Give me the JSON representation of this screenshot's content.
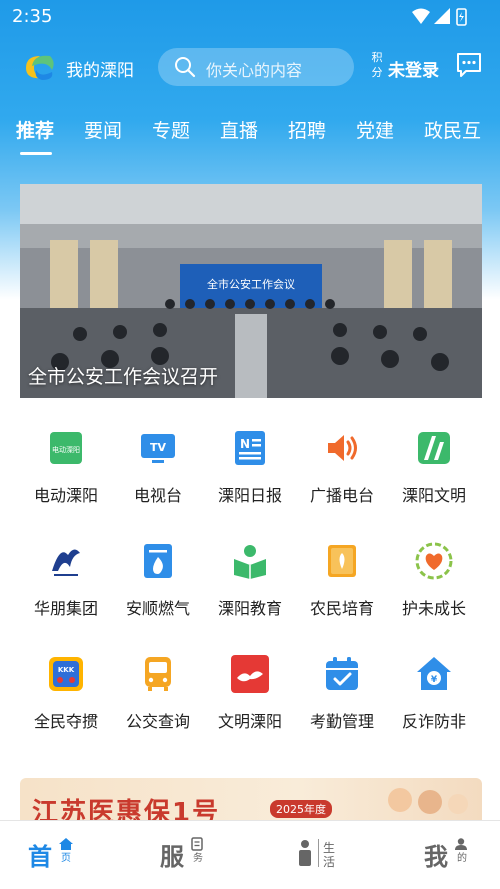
{
  "status": {
    "time": "2:35"
  },
  "header": {
    "app_title": "我的溧阳",
    "search_placeholder": "你关心的内容",
    "points_label": "积分",
    "login_label": "未登录"
  },
  "tabs": [
    {
      "label": "推荐",
      "active": true
    },
    {
      "label": "要闻"
    },
    {
      "label": "专题"
    },
    {
      "label": "直播"
    },
    {
      "label": "招聘"
    },
    {
      "label": "党建"
    },
    {
      "label": "政民互"
    }
  ],
  "banner": {
    "caption": "全市公安工作会议召开",
    "screen_text": "全市公安工作会议"
  },
  "services": [
    {
      "label": "电动溧阳",
      "icon": "dian-dong-liyang-icon",
      "icon_text": "电动溧阳"
    },
    {
      "label": "电视台",
      "icon": "tv-icon",
      "icon_text": "TV"
    },
    {
      "label": "溧阳日报",
      "icon": "newspaper-icon",
      "icon_text": "N"
    },
    {
      "label": "广播电台",
      "icon": "radio-speaker-icon"
    },
    {
      "label": "溧阳文明",
      "icon": "civilization-icon"
    },
    {
      "label": "华朋集团",
      "icon": "huapeng-logo-icon"
    },
    {
      "label": "安顺燃气",
      "icon": "gas-flame-icon"
    },
    {
      "label": "溧阳教育",
      "icon": "education-reader-icon"
    },
    {
      "label": "农民培育",
      "icon": "farmer-book-icon"
    },
    {
      "label": "护未成长",
      "icon": "youth-protection-icon"
    },
    {
      "label": "全民夺掼",
      "icon": "playing-cards-icon",
      "icon_text": "KKK"
    },
    {
      "label": "公交查询",
      "icon": "bus-icon"
    },
    {
      "label": "文明溧阳",
      "icon": "civilized-liyang-icon"
    },
    {
      "label": "考勤管理",
      "icon": "calendar-check-icon"
    },
    {
      "label": "反诈防非",
      "icon": "anti-fraud-house-icon"
    }
  ],
  "ad": {
    "title": "江苏医惠保1号",
    "badge": "2025年度"
  },
  "bottom_nav": [
    {
      "big": "首",
      "small": "页",
      "active": true
    },
    {
      "big": "服",
      "small": "务"
    },
    {
      "big": "",
      "small": "生活"
    },
    {
      "big": "我",
      "small": "的"
    }
  ],
  "colors": {
    "brand": "#1f9ae8",
    "active_tab": "#1e88e5"
  }
}
